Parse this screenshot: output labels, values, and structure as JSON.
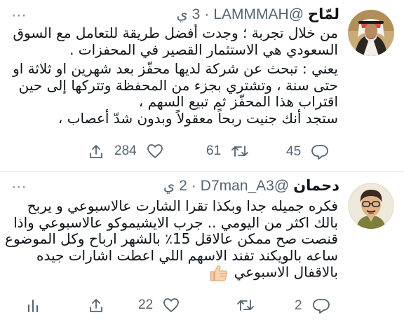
{
  "tweets": [
    {
      "name": "لمّاح",
      "handle": "@LAMMMAH",
      "dot": "·",
      "time": "3 ي",
      "lines": [
        "من خلال تجربة ؛ وجدت أفضل طريقة للتعامل مع السوق",
        "السعودي هي الاستثمار القصير في المحفزات .",
        "يعني : تبحث عن شركة لديها محفّز بعد شهرين او ثلاثة او",
        "حتى سنة ، وتشتري بجزء من المحفظة وتتركها إلى حين",
        "اقتراب هذا المحفّز ثم تبيع السهم ،",
        "ستجد أنك جنيت ربحاً معقولاً وبدون شدّ أعصاب ،"
      ],
      "actions": {
        "comments": "45",
        "retweets": "61",
        "likes": "284"
      }
    },
    {
      "name": "دحمان",
      "handle": "@D7man_A3",
      "dot": "·",
      "time": "2 ي",
      "lines": [
        "فكره جميله جدا وبكذا تقرا الشارت عالاسبوعي و يربح",
        "بالك اكثر من اليومي .. جرب الايشيموكو عالاسبوعي واذا",
        "قنصت صح ممكن عالاقل 15٪ بالشهر ارباح وكل الموضوع",
        "ساعه بالويكند تفند الاسهم اللي اعطت اشارات جيده",
        "بالاقفال الاسبوعي"
      ],
      "emoji": "thumbs-up-icon",
      "actions": {
        "comments": "2",
        "likes": "22"
      }
    }
  ],
  "colors": {
    "text": "#0f1419",
    "muted": "#536471",
    "divider": "#e1e6ea"
  }
}
